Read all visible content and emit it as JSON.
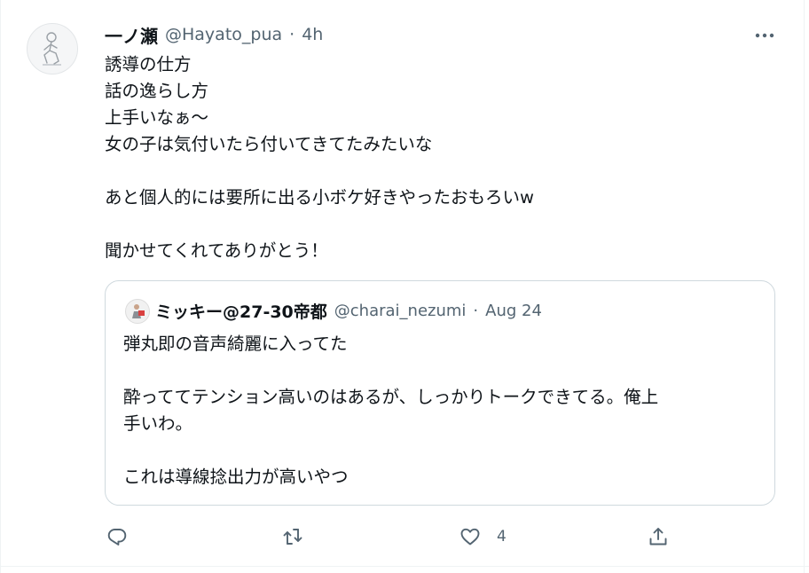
{
  "tweet": {
    "author_name": "一ノ瀬",
    "author_handle": "@Hayato_pua",
    "separator": "·",
    "time": "4h",
    "lines": [
      "誘導の仕方",
      "話の逸らし方",
      "上手いなぁ〜",
      "女の子は気付いたら付いてきてたみたいな",
      "",
      "あと個人的には要所に出る小ボケ好きやったおもろいw",
      "",
      "聞かせてくれてありがとう！"
    ]
  },
  "quote": {
    "author_name": "ミッキー@27-30帝都",
    "author_handle": "@charai_nezumi",
    "separator": "·",
    "date": "Aug 24",
    "lines": [
      "弾丸即の音声綺麗に入ってた",
      "",
      "酔っててテンション高いのはあるが、しっかりトークできてる。俺上",
      "手いわ。",
      "",
      "これは導線捻出力が高いやつ"
    ]
  },
  "actions": {
    "like_count": "4"
  },
  "icons": {
    "more": "more-horizontal-icon",
    "reply": "reply-icon",
    "retweet": "retweet-icon",
    "like": "heart-icon",
    "share": "share-icon"
  },
  "colors": {
    "text_primary": "#0f1419",
    "text_secondary": "#536471",
    "border": "#cfd9de"
  }
}
